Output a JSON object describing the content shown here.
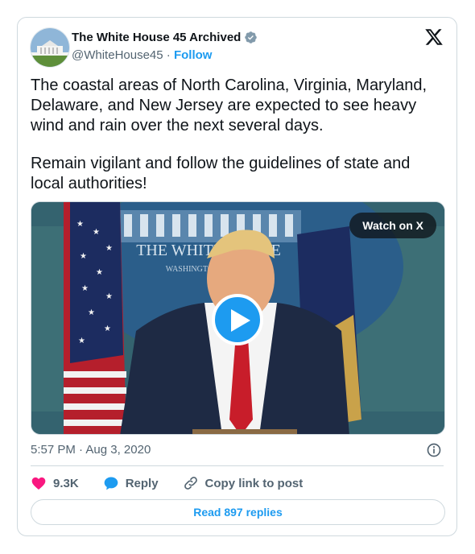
{
  "author": {
    "display_name": "The White House 45 Archived",
    "handle": "@WhiteHouse45",
    "separator": "·",
    "follow_label": "Follow",
    "verified_color": "#829aab"
  },
  "tweet": {
    "paragraphs": [
      "The coastal areas of North Carolina, Virginia, Maryland, Delaware, and New Jersey are expected to see heavy wind and rain over the next several days.",
      "Remain vigilant and follow the guidelines of state and local authorities!"
    ]
  },
  "media": {
    "watch_label": "Watch on X",
    "podium_text": "THE WHITE HOUSE",
    "podium_subtext": "WASHINGTON"
  },
  "meta": {
    "time": "5:57 PM",
    "date_separator": "·",
    "date": "Aug 3, 2020"
  },
  "actions": {
    "likes_count": "9.3K",
    "reply_label": "Reply",
    "copy_label": "Copy link to post"
  },
  "read_replies_label": "Read 897 replies",
  "colors": {
    "accent": "#1d9bf0",
    "like": "#f91880",
    "secondary_text": "#536471",
    "border": "#cfd9de"
  }
}
